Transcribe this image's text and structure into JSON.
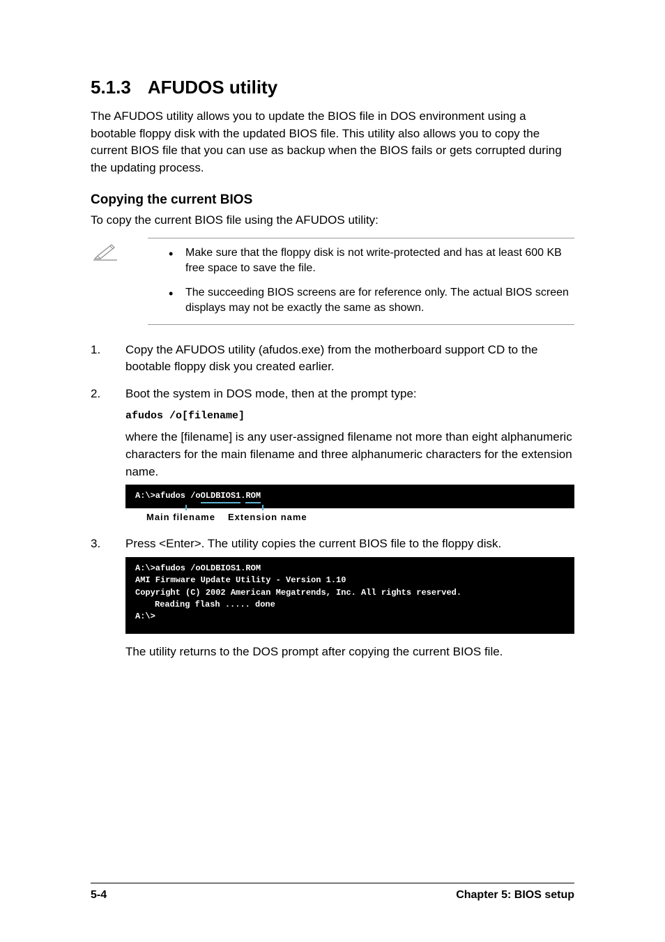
{
  "section": {
    "number": "5.1.3",
    "title": "AFUDOS utility",
    "intro": "The AFUDOS utility allows you to update the BIOS file in DOS environment using a bootable floppy disk with the updated BIOS file. This utility also allows you to copy the current BIOS file that you can use as backup when the BIOS fails or gets corrupted during the updating process."
  },
  "subsection": {
    "title": "Copying the current BIOS",
    "intro": "To copy the current BIOS file using the AFUDOS utility:"
  },
  "notes": [
    "Make sure that the floppy disk is not write-protected and has at least 600 KB free space to save the file.",
    "The succeeding BIOS screens are for reference only. The actual BIOS screen displays may not be exactly the same as shown."
  ],
  "steps": {
    "1": "Copy the AFUDOS utility (afudos.exe) from the motherboard support CD to the bootable floppy disk you created earlier.",
    "2": {
      "text": "Boot the system in DOS mode, then at the prompt type:",
      "code": "afudos /o[filename]",
      "explain": "where the [filename] is any user-assigned filename not more than eight alphanumeric characters  for the main filename and three alphanumeric characters for the extension name."
    },
    "3": "Press <Enter>. The utility copies the current BIOS file to the floppy disk."
  },
  "console1": {
    "prefix": "A:\\>afudos /o",
    "mainname": "OLDBIOS1",
    "dot": ".",
    "ext": "ROM"
  },
  "annotation": {
    "main": "Main filename",
    "ext": "Extension name"
  },
  "console2": {
    "line1": "A:\\>afudos /oOLDBIOS1.ROM",
    "line2": "AMI Firmware Update Utility - Version 1.10",
    "line3": "Copyright (C) 2002 American Megatrends, Inc. All rights reserved.",
    "line4": "Reading flash ..... done",
    "line5": "A:\\>"
  },
  "postConsole": "The utility returns to the DOS prompt after copying the current BIOS file.",
  "footer": {
    "page": "5-4",
    "chapterLabel": "Chapter 5: ",
    "chapterTitle": "BIOS setup"
  }
}
